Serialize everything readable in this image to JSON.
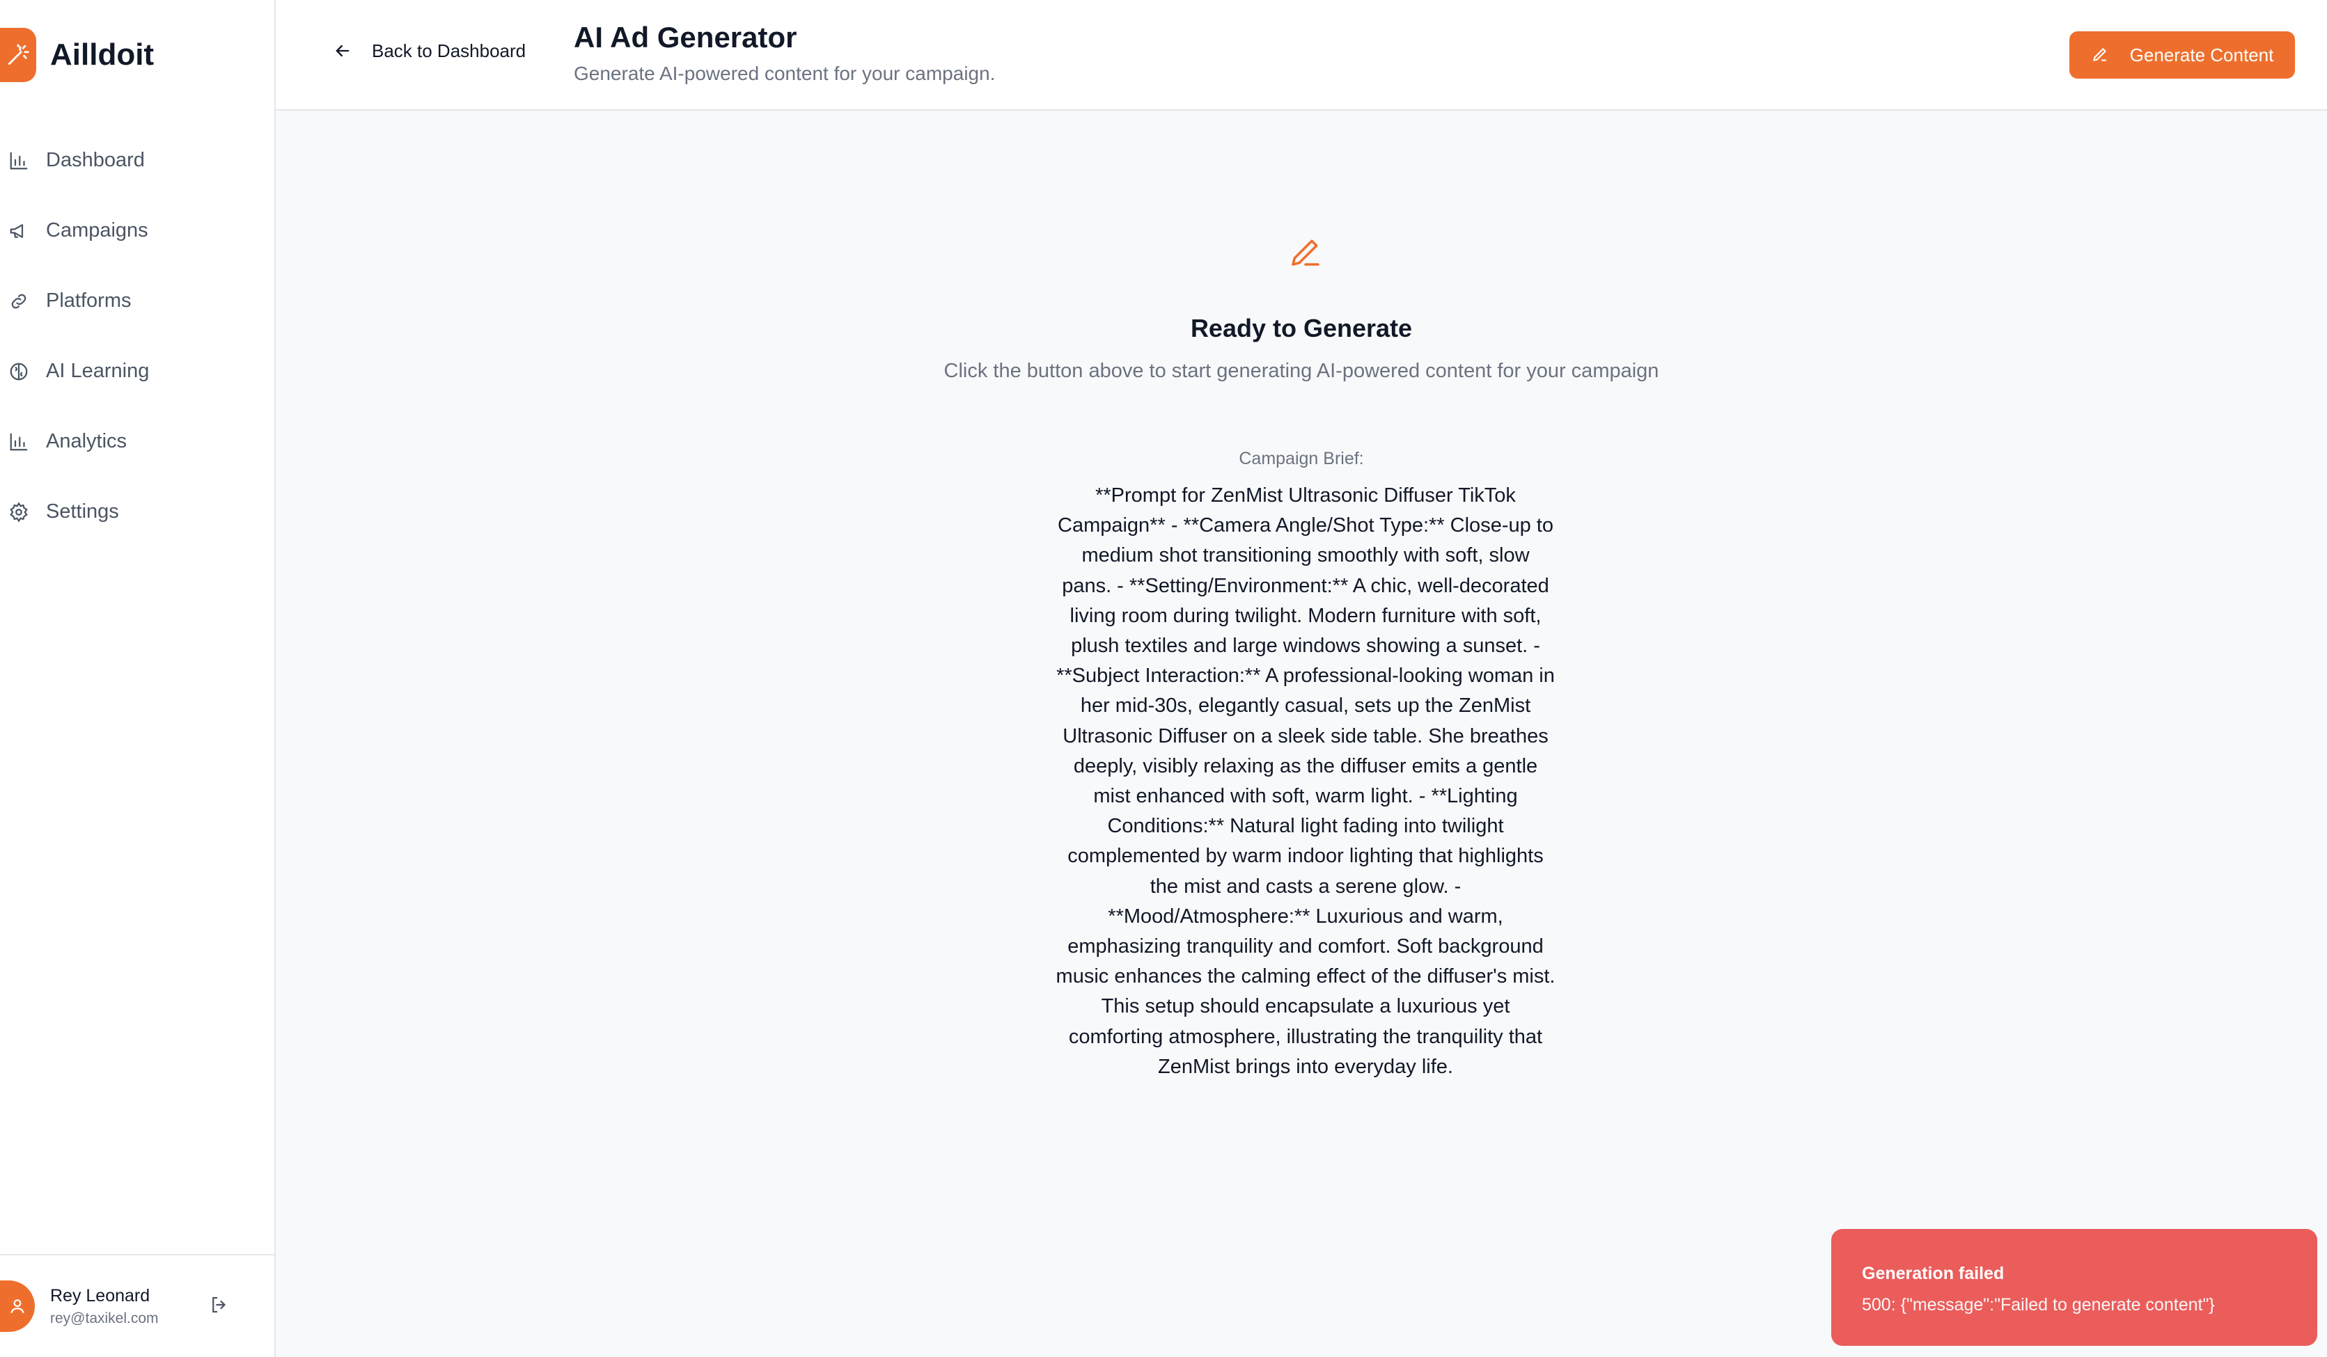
{
  "brand": {
    "name": "Ailldoit",
    "accent": "#ee6f2d"
  },
  "sidebar": {
    "items": [
      {
        "label": "Dashboard",
        "icon": "bar-chart-icon"
      },
      {
        "label": "Campaigns",
        "icon": "megaphone-icon"
      },
      {
        "label": "Platforms",
        "icon": "link-icon"
      },
      {
        "label": "AI Learning",
        "icon": "brain-icon"
      },
      {
        "label": "Analytics",
        "icon": "bar-chart-icon"
      },
      {
        "label": "Settings",
        "icon": "gear-icon"
      }
    ]
  },
  "user": {
    "name": "Rey Leonard",
    "email": "rey@taxikel.com"
  },
  "header": {
    "back_label": "Back to Dashboard",
    "title": "AI Ad Generator",
    "subtitle": "Generate AI-powered content for your campaign.",
    "generate_label": "Generate Content"
  },
  "main": {
    "ready_title": "Ready to Generate",
    "ready_subtitle": "Click the button above to start generating AI-powered content for your campaign",
    "brief_label": "Campaign Brief:",
    "brief_text": "**Prompt for ZenMist Ultrasonic Diffuser TikTok Campaign** - **Camera Angle/Shot Type:** Close-up to medium shot transitioning smoothly with soft, slow pans. - **Setting/Environment:** A chic, well-decorated living room during twilight. Modern furniture with soft, plush textiles and large windows showing a sunset. - **Subject Interaction:** A professional-looking woman in her mid-30s, elegantly casual, sets up the ZenMist Ultrasonic Diffuser on a sleek side table. She breathes deeply, visibly relaxing as the diffuser emits a gentle mist enhanced with soft, warm light. - **Lighting Conditions:** Natural light fading into twilight complemented by warm indoor lighting that highlights the mist and casts a serene glow. - **Mood/Atmosphere:** Luxurious and warm, emphasizing tranquility and comfort. Soft background music enhances the calming effect of the diffuser's mist. This setup should encapsulate a luxurious yet comforting atmosphere, illustrating the tranquility that ZenMist brings into everyday life."
  },
  "toast": {
    "title": "Generation failed",
    "message": "500: {\"message\":\"Failed to generate content\"}",
    "color": "#ea5d5b"
  }
}
